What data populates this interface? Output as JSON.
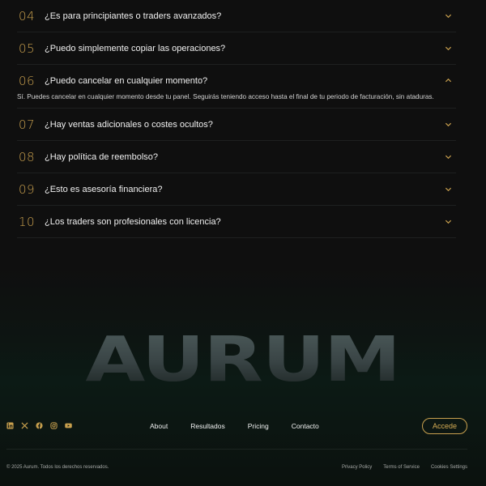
{
  "faq": {
    "items": [
      {
        "num": "04",
        "question": "¿Es para principiantes o traders avanzados?",
        "expanded": false
      },
      {
        "num": "05",
        "question": "¿Puedo simplemente copiar las operaciones?",
        "expanded": false
      },
      {
        "num": "06",
        "question": "¿Puedo cancelar en cualquier momento?",
        "expanded": true,
        "answer": "Sí. Puedes cancelar en cualquier momento desde tu panel. Seguirás teniendo acceso hasta el final de tu periodo de facturación, sin ataduras."
      },
      {
        "num": "07",
        "question": "¿Hay ventas adicionales o costes ocultos?",
        "expanded": false
      },
      {
        "num": "08",
        "question": "¿Hay política de reembolso?",
        "expanded": false
      },
      {
        "num": "09",
        "question": "¿Esto es asesoría financiera?",
        "expanded": false
      },
      {
        "num": "10",
        "question": "¿Los traders son profesionales con licencia?",
        "expanded": false
      }
    ]
  },
  "brand": {
    "wordmark": "AURUM"
  },
  "footer": {
    "socials": [
      "linkedin-icon",
      "x-icon",
      "facebook-icon",
      "instagram-icon",
      "youtube-icon"
    ],
    "nav": [
      "About",
      "Resultados",
      "Pricing",
      "Contacto"
    ],
    "cta_label": "Accede",
    "copyright": "© 2025 Aurum. Todos los derechos reservados.",
    "legal": [
      "Privacy Policy",
      "Terms of Service",
      "Cookies Settings"
    ]
  },
  "colors": {
    "accent": "#c9a04e",
    "background": "#0f0f0f",
    "text": "#f0f0f0"
  }
}
